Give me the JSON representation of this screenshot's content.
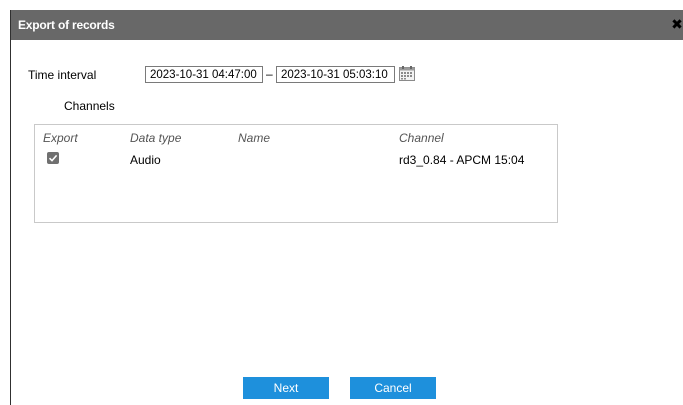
{
  "dialog": {
    "title": "Export of records",
    "close_icon": "close-icon"
  },
  "time_interval": {
    "label": "Time interval",
    "start": "2023-10-31 04:47:00",
    "separator": "–",
    "end": "2023-10-31 05:03:10",
    "calendar_icon": "calendar-icon"
  },
  "channels": {
    "label": "Channels",
    "columns": [
      "Export",
      "Data type",
      "Name",
      "Channel"
    ],
    "rows": [
      {
        "export": true,
        "data_type": "Audio",
        "name": "",
        "channel": "rd3_0.84 - APCM 15:04"
      }
    ]
  },
  "buttons": {
    "next": "Next",
    "cancel": "Cancel"
  },
  "colors": {
    "titlebar": "#686868",
    "button": "#1e90dc"
  }
}
